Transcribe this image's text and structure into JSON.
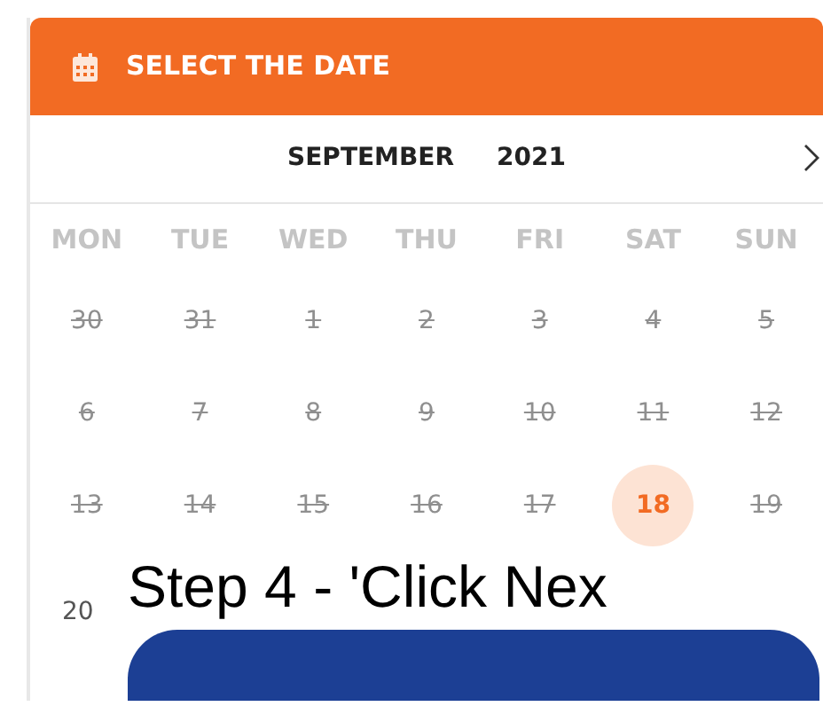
{
  "header": {
    "title": "SELECT THE DATE"
  },
  "month_nav": {
    "month": "SEPTEMBER",
    "year": "2021"
  },
  "weekdays": [
    "MON",
    "TUE",
    "WED",
    "THU",
    "FRI",
    "SAT",
    "SUN"
  ],
  "weeks": [
    [
      {
        "day": "30",
        "disabled": true,
        "selected": false
      },
      {
        "day": "31",
        "disabled": true,
        "selected": false
      },
      {
        "day": "1",
        "disabled": true,
        "selected": false
      },
      {
        "day": "2",
        "disabled": true,
        "selected": false
      },
      {
        "day": "3",
        "disabled": true,
        "selected": false
      },
      {
        "day": "4",
        "disabled": true,
        "selected": false
      },
      {
        "day": "5",
        "disabled": true,
        "selected": false
      }
    ],
    [
      {
        "day": "6",
        "disabled": true,
        "selected": false
      },
      {
        "day": "7",
        "disabled": true,
        "selected": false
      },
      {
        "day": "8",
        "disabled": true,
        "selected": false
      },
      {
        "day": "9",
        "disabled": true,
        "selected": false
      },
      {
        "day": "10",
        "disabled": true,
        "selected": false
      },
      {
        "day": "11",
        "disabled": true,
        "selected": false
      },
      {
        "day": "12",
        "disabled": true,
        "selected": false
      }
    ],
    [
      {
        "day": "13",
        "disabled": true,
        "selected": false
      },
      {
        "day": "14",
        "disabled": true,
        "selected": false
      },
      {
        "day": "15",
        "disabled": true,
        "selected": false
      },
      {
        "day": "16",
        "disabled": true,
        "selected": false
      },
      {
        "day": "17",
        "disabled": true,
        "selected": false
      },
      {
        "day": "18",
        "disabled": false,
        "selected": true
      },
      {
        "day": "19",
        "disabled": true,
        "selected": false
      }
    ]
  ],
  "next_row_day": "20",
  "overlay": {
    "caption": "Step 4 - 'Click Nex"
  }
}
